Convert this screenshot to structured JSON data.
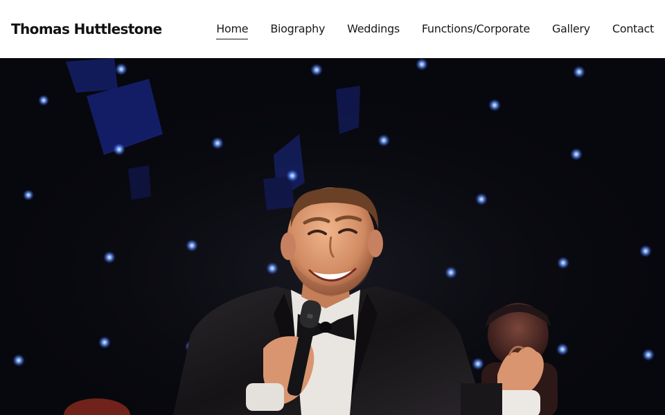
{
  "header": {
    "site_title": "Thomas Huttlestone"
  },
  "nav": {
    "items": [
      {
        "label": "Home",
        "active": true
      },
      {
        "label": "Biography",
        "active": false
      },
      {
        "label": "Weddings",
        "active": false
      },
      {
        "label": "Functions/Corporate",
        "active": false
      },
      {
        "label": "Gallery",
        "active": false
      },
      {
        "label": "Contact",
        "active": false
      }
    ]
  },
  "hero": {
    "image_subject": "singer-on-stage-photo",
    "colors": {
      "backdrop": "#07080d",
      "star_light": "#7fb2ff",
      "blue_spill": "#1a2a8c",
      "suit": "#1c1a1c",
      "skin": "#d8946c",
      "hair": "#6a4026"
    }
  }
}
